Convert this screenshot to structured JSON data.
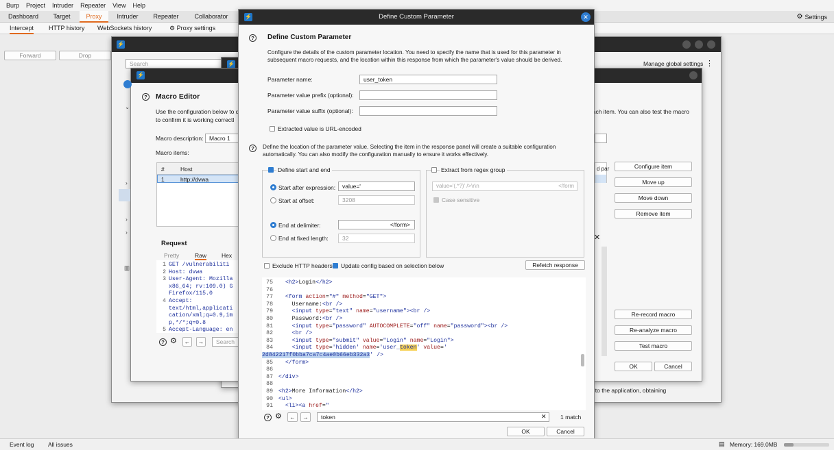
{
  "menu": [
    "Burp",
    "Project",
    "Intruder",
    "Repeater",
    "View",
    "Help"
  ],
  "main_tabs": [
    "Dashboard",
    "Target",
    "Proxy",
    "Intruder",
    "Repeater",
    "Collaborator"
  ],
  "settings_label": "Settings",
  "sub_tabs": [
    "Intercept",
    "HTTP history",
    "WebSockets history",
    "Proxy settings"
  ],
  "intercept": {
    "forward": "Forward",
    "drop": "Drop"
  },
  "status": {
    "event_log": "Event log",
    "all_issues": "All issues",
    "memory": "Memory: 169.0MB"
  },
  "bg_window": {
    "search_placeholder": "Search",
    "manage_global": "Manage global settings",
    "obtaining": "ng in to the application, obtaining"
  },
  "macro_editor": {
    "title": "Macro Editor",
    "desc1": "Use the configuration below to d",
    "desc2": "to confirm it is working correctl",
    "desc_right": "each item. You can also test the macro",
    "macro_desc_label": "Macro description:",
    "macro_desc_value": "Macro 1",
    "macro_items_label": "Macro items:",
    "col_num": "#",
    "col_host": "Host",
    "col_right": "d par",
    "row_num": "1",
    "row_host": "http://dvwa",
    "buttons": [
      "Configure item",
      "Move up",
      "Move down",
      "Remove item"
    ],
    "buttons2": [
      "Re-record macro",
      "Re-analyze macro",
      "Test macro"
    ],
    "ok": "OK",
    "cancel": "Cancel",
    "request_label": "Request",
    "req_tabs": [
      "Pretty",
      "Raw",
      "Hex"
    ],
    "req_lines": [
      "GET /vulnerabiliti",
      "Host: dvwa",
      "User-Agent: Mozilla",
      "x86_64; rv:109.0) G",
      "Firefox/115.0",
      "Accept:",
      "text/html,applicati",
      "cation/xml;q=0.9,im",
      "p,*/*;q=0.8",
      "Accept-Language: en"
    ],
    "req_line_nums": [
      "1",
      "2",
      "3",
      "",
      "",
      "4",
      "",
      "",
      "",
      "5"
    ],
    "search_placeholder": "Search"
  },
  "dialog": {
    "title": "Define Custom Parameter",
    "heading": "Define Custom Parameter",
    "desc1": "Configure the details of the custom parameter location. You need to specify the name that is used for this parameter in",
    "desc2": "subsequent macro requests, and the location within this response from which the parameter's value should be derived.",
    "param_name_label": "Parameter name:",
    "param_name_value": "user_token",
    "prefix_label": "Parameter value prefix (optional):",
    "suffix_label": "Parameter value suffix (optional):",
    "url_encoded_label": "Extracted value is URL-encoded",
    "loc_desc1": "Define the location of the parameter value. Selecting the item in the response panel will create a suitable configuration",
    "loc_desc2": "automatically. You can also modify the configuration manually to ensure it works effectively.",
    "define_start_end": "Define start and end",
    "start_after_label": "Start after expression:",
    "start_after_value": "value='",
    "start_offset_label": "Start at offset:",
    "start_offset_value": "3208",
    "end_delim_label": "End at delimiter:",
    "end_delim_value": "</form>",
    "end_fixed_label": "End at fixed length:",
    "end_fixed_value": "32",
    "regex_label": "Extract from regex group",
    "regex_value": "value='(.*?)' />\\r\\n",
    "regex_right": "</form",
    "case_sensitive": "Case sensitive",
    "exclude_headers": "Exclude HTTP headers",
    "update_config": "Update config based on selection below",
    "refetch": "Refetch response",
    "search_value": "token",
    "match_count": "1 match",
    "ok": "OK",
    "cancel": "Cancel",
    "token_value": "2d842217f0bba7ca7c4ae0b66eb332a3"
  },
  "colors": {
    "accent": "#e06a1f",
    "selection": "#2f7dd1",
    "highlight": "#f7d154"
  }
}
